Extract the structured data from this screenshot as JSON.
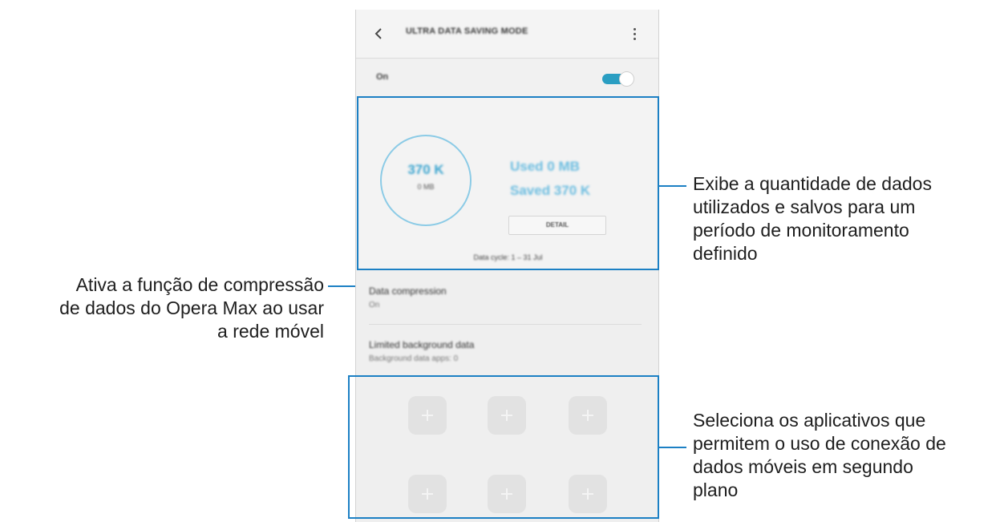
{
  "screen": {
    "title": "ULTRA DATA SAVING MODE",
    "back_icon": "chevron-left-icon",
    "more_icon": "more-vertical-icon",
    "onoff_label": "On",
    "toggle_state": "on",
    "accent_color": "#2a9ec2",
    "frame_color": "#1c80c4"
  },
  "stats": {
    "ring_value": "370 K",
    "ring_sub": "0 MB",
    "used": "Used 0 MB",
    "saved": "Saved 370 K",
    "detail_button": "DETAIL",
    "cycle": "Data cycle: 1 – 31 Jul"
  },
  "settings": {
    "compression_title": "Data compression",
    "compression_value": "On",
    "limited_title": "Limited background data",
    "limited_value": "Background data apps: 0"
  },
  "apps": {
    "slot_icon": "plus-icon",
    "slots": 6
  },
  "callouts": {
    "stats_lines": [
      "Exibe a quantidade de dados",
      "utilizados e salvos para um",
      "período de monitoramento",
      "definido"
    ],
    "compression_lines": [
      "Ativa a função de compressão",
      "de dados do Opera Max ao usar",
      "a rede móvel"
    ],
    "apps_lines": [
      "Seleciona os aplicativos que",
      "permitem o uso de conexão de",
      "dados móveis em segundo",
      "plano"
    ]
  }
}
